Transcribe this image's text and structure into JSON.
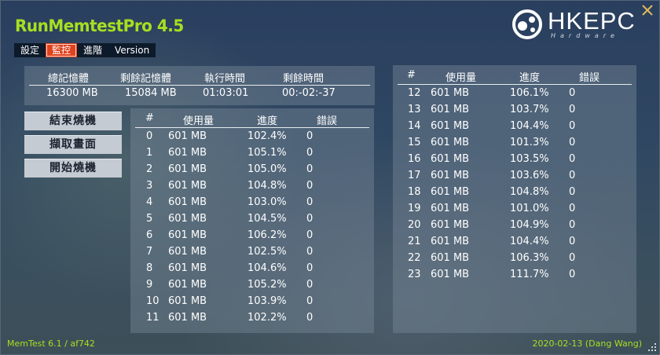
{
  "app": {
    "title": "RunMemtestPro 4.5"
  },
  "logo": {
    "word": "HKEPC",
    "sub": "Hardware"
  },
  "menu": {
    "items": [
      {
        "label": "設定"
      },
      {
        "label": "監控",
        "active": true
      },
      {
        "label": "進階"
      },
      {
        "label": "Version"
      }
    ]
  },
  "summary": {
    "headers": {
      "total": "總記憶體",
      "remaining": "剩餘記憶體",
      "elapsed": "執行時間",
      "left": "剩餘時間"
    },
    "values": {
      "total": "16300 MB",
      "remaining": "15084 MB",
      "elapsed": "01:03:01",
      "left": "00:-02:-37"
    }
  },
  "buttons": {
    "stop": "結束燒機",
    "capture": "擷取畫面",
    "start": "開始燒機"
  },
  "table": {
    "columns": {
      "index": "#",
      "usage": "使用量",
      "progress": "進度",
      "errors": "錯誤"
    },
    "left_rows": [
      {
        "i": "0",
        "mem": "601 MB",
        "pct": "102.4%",
        "err": "0"
      },
      {
        "i": "1",
        "mem": "601 MB",
        "pct": "105.1%",
        "err": "0"
      },
      {
        "i": "2",
        "mem": "601 MB",
        "pct": "105.0%",
        "err": "0"
      },
      {
        "i": "3",
        "mem": "601 MB",
        "pct": "104.8%",
        "err": "0"
      },
      {
        "i": "4",
        "mem": "601 MB",
        "pct": "103.0%",
        "err": "0"
      },
      {
        "i": "5",
        "mem": "601 MB",
        "pct": "104.5%",
        "err": "0"
      },
      {
        "i": "6",
        "mem": "601 MB",
        "pct": "106.2%",
        "err": "0"
      },
      {
        "i": "7",
        "mem": "601 MB",
        "pct": "102.5%",
        "err": "0"
      },
      {
        "i": "8",
        "mem": "601 MB",
        "pct": "104.6%",
        "err": "0"
      },
      {
        "i": "9",
        "mem": "601 MB",
        "pct": "105.2%",
        "err": "0"
      },
      {
        "i": "10",
        "mem": "601 MB",
        "pct": "103.9%",
        "err": "0"
      },
      {
        "i": "11",
        "mem": "601 MB",
        "pct": "102.2%",
        "err": "0"
      }
    ],
    "right_rows": [
      {
        "i": "12",
        "mem": "601 MB",
        "pct": "106.1%",
        "err": "0"
      },
      {
        "i": "13",
        "mem": "601 MB",
        "pct": "103.7%",
        "err": "0"
      },
      {
        "i": "14",
        "mem": "601 MB",
        "pct": "104.4%",
        "err": "0"
      },
      {
        "i": "15",
        "mem": "601 MB",
        "pct": "101.3%",
        "err": "0"
      },
      {
        "i": "16",
        "mem": "601 MB",
        "pct": "103.5%",
        "err": "0"
      },
      {
        "i": "17",
        "mem": "601 MB",
        "pct": "103.6%",
        "err": "0"
      },
      {
        "i": "18",
        "mem": "601 MB",
        "pct": "104.8%",
        "err": "0"
      },
      {
        "i": "19",
        "mem": "601 MB",
        "pct": "101.0%",
        "err": "0"
      },
      {
        "i": "20",
        "mem": "601 MB",
        "pct": "104.9%",
        "err": "0"
      },
      {
        "i": "21",
        "mem": "601 MB",
        "pct": "104.4%",
        "err": "0"
      },
      {
        "i": "22",
        "mem": "601 MB",
        "pct": "106.3%",
        "err": "0"
      },
      {
        "i": "23",
        "mem": "601 MB",
        "pct": "111.7%",
        "err": "0"
      }
    ]
  },
  "footer": {
    "left": "MemTest 6.1 / af742",
    "right": "2020-02-13 (Dang Wang)"
  },
  "icons": {
    "close": "close-icon",
    "logo": "hkepc-logo-icon",
    "grip": "resize-grip-icon"
  },
  "colors": {
    "accent": "#a6e020",
    "active_tab": "#e0421e",
    "close": "#e0b85a"
  }
}
